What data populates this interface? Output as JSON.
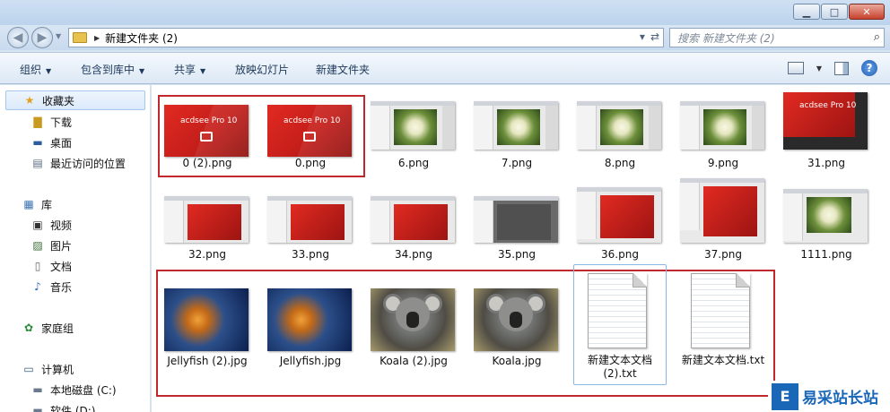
{
  "window": {
    "controls": {
      "minimize": "▁",
      "maximize": "□",
      "close": "✕"
    }
  },
  "address": {
    "path": "新建文件夹 (2)",
    "search_placeholder": "搜索 新建文件夹 (2)"
  },
  "toolbar": {
    "organize": "组织",
    "include_in_library": "包含到库中",
    "share": "共享",
    "slideshow": "放映幻灯片",
    "new_folder": "新建文件夹",
    "help": "?"
  },
  "nav": {
    "favorites": "收藏夹",
    "downloads": "下载",
    "desktop": "桌面",
    "recent": "最近访问的位置",
    "libraries": "库",
    "videos": "视频",
    "pictures": "图片",
    "documents": "文档",
    "music": "音乐",
    "homegroup": "家庭组",
    "computer": "计算机",
    "local_disk": "本地磁盘 (C:)",
    "soft_disk": "软件 (D:)"
  },
  "files": [
    {
      "name": "0 (2).png",
      "kind": "acdsee",
      "label": "acdsee Pro 10"
    },
    {
      "name": "0.png",
      "kind": "acdsee",
      "label": "acdsee Pro 10"
    },
    {
      "name": "6.png",
      "kind": "screen-flower"
    },
    {
      "name": "7.png",
      "kind": "screen-flower"
    },
    {
      "name": "8.png",
      "kind": "screen-flower"
    },
    {
      "name": "9.png",
      "kind": "screen-flower"
    },
    {
      "name": "31.png",
      "kind": "acdsee-dark",
      "label": "acdsee Pro 10"
    },
    {
      "name": "32.png",
      "kind": "screen-red"
    },
    {
      "name": "33.png",
      "kind": "screen-red"
    },
    {
      "name": "34.png",
      "kind": "screen-red"
    },
    {
      "name": "35.png",
      "kind": "screen-dark"
    },
    {
      "name": "36.png",
      "kind": "screen-red"
    },
    {
      "name": "37.png",
      "kind": "screen-red"
    },
    {
      "name": "1111.png",
      "kind": "screen-flower"
    },
    {
      "name": "Jellyfish (2).jpg",
      "kind": "jelly"
    },
    {
      "name": "Jellyfish.jpg",
      "kind": "jelly"
    },
    {
      "name": "Koala (2).jpg",
      "kind": "koala"
    },
    {
      "name": "Koala.jpg",
      "kind": "koala"
    },
    {
      "name": "新建文本文档 (2).txt",
      "kind": "txt"
    },
    {
      "name": "新建文本文档.txt",
      "kind": "txt"
    }
  ],
  "watermark": {
    "logo": "E",
    "text": "易采站长站"
  },
  "colors": {
    "highlight_box": "#c0282e",
    "acdsee_red": "#e12a21",
    "toolbar_text": "#1e395b"
  }
}
